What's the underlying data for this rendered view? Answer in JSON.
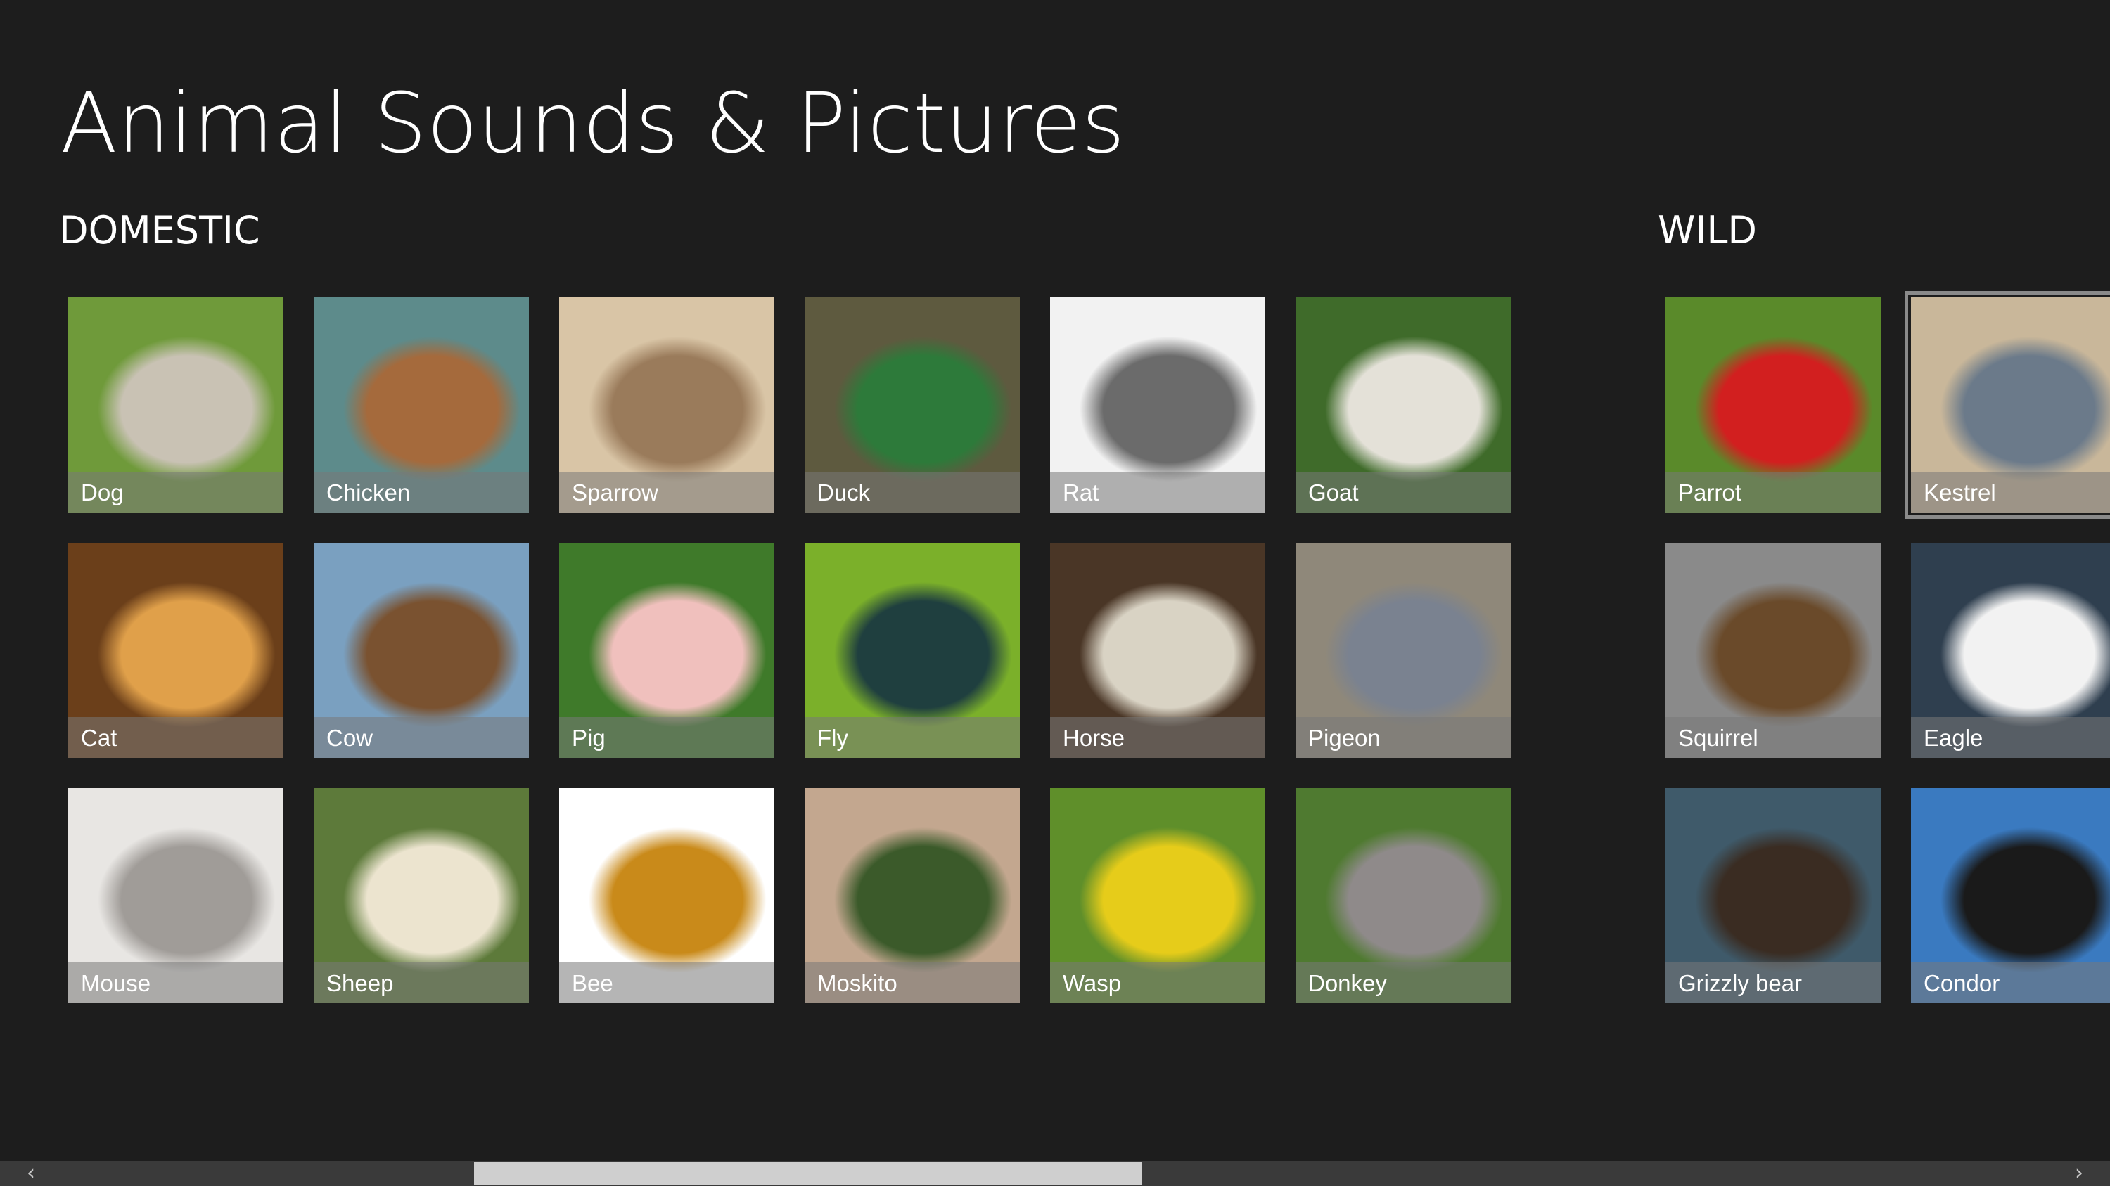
{
  "app": {
    "title": "Animal Sounds & Pictures"
  },
  "groups": {
    "domestic": {
      "header": "DOMESTIC",
      "tiles": [
        {
          "label": "Dog",
          "icon": "dog-photo",
          "bg": "#6f9a3a",
          "bg2": "#c9c2b4"
        },
        {
          "label": "Chicken",
          "icon": "chicken-photo",
          "bg": "#5d8b8b",
          "bg2": "#a56a3c"
        },
        {
          "label": "Sparrow",
          "icon": "sparrow-photo",
          "bg": "#d9c5a6",
          "bg2": "#9a7b5b"
        },
        {
          "label": "Duck",
          "icon": "duck-photo",
          "bg": "#5e5a3f",
          "bg2": "#2d7a3a"
        },
        {
          "label": "Rat",
          "icon": "rat-photo",
          "bg": "#f2f2f2",
          "bg2": "#6b6b6b"
        },
        {
          "label": "Goat",
          "icon": "goat-photo",
          "bg": "#3f6b2a",
          "bg2": "#e4e1d8"
        },
        {
          "label": "Cat",
          "icon": "cat-photo",
          "bg": "#6b3f1a",
          "bg2": "#e0a04a"
        },
        {
          "label": "Cow",
          "icon": "cow-photo",
          "bg": "#7aa0c0",
          "bg2": "#7a5230"
        },
        {
          "label": "Pig",
          "icon": "pig-photo",
          "bg": "#3f7a2a",
          "bg2": "#f0c0bd"
        },
        {
          "label": "Fly",
          "icon": "fly-photo",
          "bg": "#7bb02a",
          "bg2": "#1f3f3f"
        },
        {
          "label": "Horse",
          "icon": "horse-photo",
          "bg": "#4a3626",
          "bg2": "#d9d3c4"
        },
        {
          "label": "Pigeon",
          "icon": "pigeon-photo",
          "bg": "#8f887a",
          "bg2": "#7a8290"
        },
        {
          "label": "Mouse",
          "icon": "mouse-photo",
          "bg": "#e8e6e3",
          "bg2": "#a09c98"
        },
        {
          "label": "Sheep",
          "icon": "sheep-photo",
          "bg": "#5d7a3a",
          "bg2": "#ece4cf"
        },
        {
          "label": "Bee",
          "icon": "bee-photo",
          "bg": "#ffffff",
          "bg2": "#c98a1a"
        },
        {
          "label": "Moskito",
          "icon": "mosquito-photo",
          "bg": "#c3a78f",
          "bg2": "#3b5a2a"
        },
        {
          "label": "Wasp",
          "icon": "wasp-photo",
          "bg": "#5f8f2a",
          "bg2": "#e6cc1a"
        },
        {
          "label": "Donkey",
          "icon": "donkey-photo",
          "bg": "#4f7a30",
          "bg2": "#8f8a8a"
        }
      ]
    },
    "wild": {
      "header": "WILD",
      "tiles": [
        {
          "label": "Parrot",
          "icon": "parrot-photo",
          "bg": "#5a8a2a",
          "bg2": "#d21f1f"
        },
        {
          "label": "Kestrel",
          "icon": "kestrel-photo",
          "bg": "#c9b79a",
          "bg2": "#6b7a8a"
        },
        {
          "label": "Squirrel",
          "icon": "squirrel-photo",
          "bg": "#8a8a8a",
          "bg2": "#6a4a2a"
        },
        {
          "label": "Eagle",
          "icon": "eagle-photo",
          "bg": "#2f3f4f",
          "bg2": "#f2f2f2"
        },
        {
          "label": "Grizzly bear",
          "icon": "bear-photo",
          "bg": "#3f5a6a",
          "bg2": "#3a2c22"
        },
        {
          "label": "Condor",
          "icon": "condor-photo",
          "bg": "#3a7ac0",
          "bg2": "#1a1a1a"
        }
      ]
    }
  },
  "scrollbar": {
    "left_arrow": "‹",
    "right_arrow": "›"
  }
}
